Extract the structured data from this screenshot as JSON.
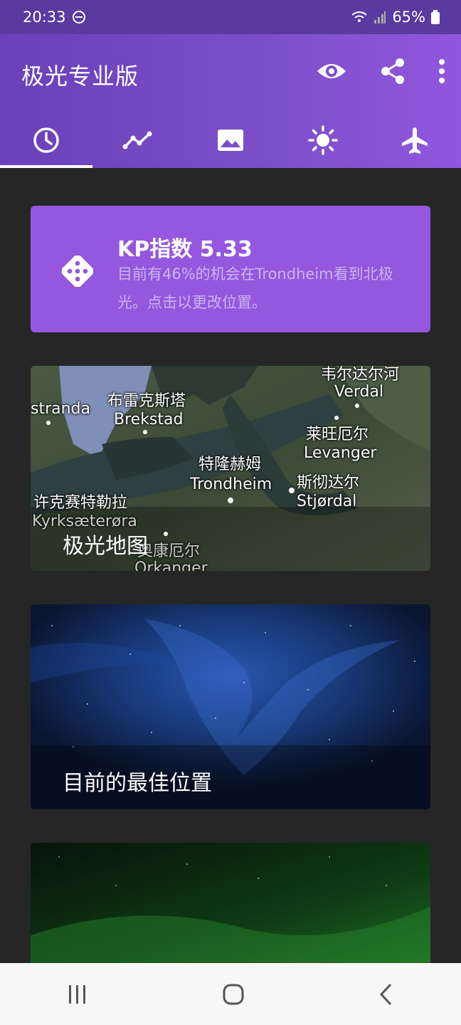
{
  "status": {
    "time": "20:33",
    "battery": "65%"
  },
  "appbar": {
    "title": "极光专业版"
  },
  "icons": {
    "eye": "eye-icon",
    "share": "share-icon",
    "more": "more-vert-icon",
    "tabs": [
      "clock-icon",
      "chart-line-icon",
      "image-icon",
      "sun-icon",
      "airplane-icon"
    ]
  },
  "kp_card": {
    "title": "KP指数 5.33",
    "description": "目前有46%的机会在Trondheim看到北极光。点击以更改位置。"
  },
  "map_card": {
    "caption": "极光地图",
    "labels": [
      {
        "text": "韦尔达尔河"
      },
      {
        "text": "Verdal"
      },
      {
        "text": "布雷克斯塔"
      },
      {
        "text": "Brekstad"
      },
      {
        "text": "stranda"
      },
      {
        "text": "莱旺厄尔"
      },
      {
        "text": "Levanger"
      },
      {
        "text": "特隆赫姆"
      },
      {
        "text": "Trondheim"
      },
      {
        "text": "斯彻达尔"
      },
      {
        "text": "Stjørdal"
      },
      {
        "text": "许克赛特勒拉"
      },
      {
        "text": "Kyrksæterøra"
      },
      {
        "text": "奥康厄尔"
      },
      {
        "text": "Orkanger"
      }
    ]
  },
  "best_location_card": {
    "caption": "目前的最佳位置"
  },
  "colors": {
    "accent": "#9557de",
    "appbar_start": "#6a41b9",
    "appbar_end": "#9157de",
    "background": "#262626"
  }
}
